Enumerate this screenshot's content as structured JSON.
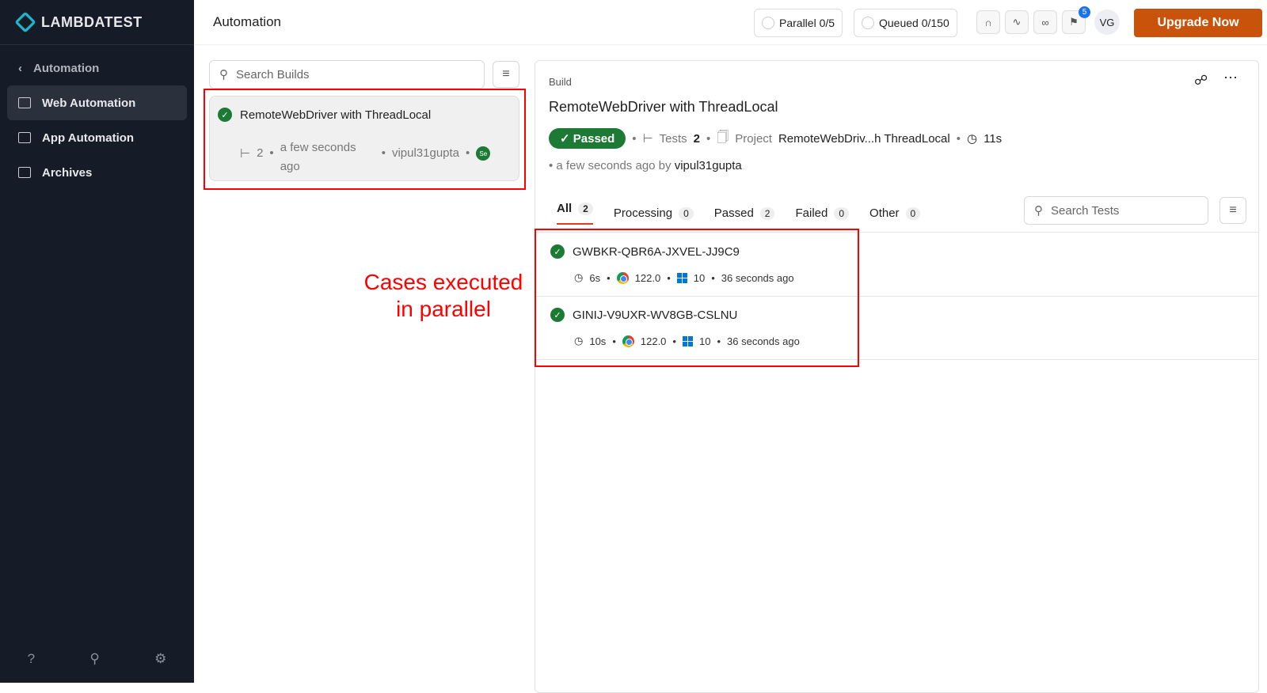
{
  "brand": "LAMBDATEST",
  "sidebar": {
    "back": "Automation",
    "items": [
      {
        "label": "Web Automation"
      },
      {
        "label": "App Automation"
      },
      {
        "label": "Archives"
      }
    ]
  },
  "topbar": {
    "title": "Automation",
    "parallel": "Parallel 0/5",
    "queued": "Queued 0/150",
    "notif_count": "5",
    "avatar": "VG",
    "upgrade": "Upgrade Now"
  },
  "builds": {
    "search_placeholder": "Search Builds",
    "card": {
      "name": "RemoteWebDriver with ThreadLocal",
      "tests": "2",
      "time": "a few seconds ago",
      "user": "vipul31gupta",
      "badge": "Se"
    }
  },
  "detail": {
    "label": "Build",
    "title": "RemoteWebDriver with ThreadLocal",
    "status": "Passed",
    "tests_label": "Tests",
    "tests": "2",
    "project_label": "Project",
    "project": "RemoteWebDriv...h ThreadLocal",
    "duration": "11s",
    "time": "a few seconds ago by",
    "user": "vipul31gupta",
    "tabs": [
      {
        "label": "All",
        "count": "2"
      },
      {
        "label": "Processing",
        "count": "0"
      },
      {
        "label": "Passed",
        "count": "2"
      },
      {
        "label": "Failed",
        "count": "0"
      },
      {
        "label": "Other",
        "count": "0"
      }
    ],
    "search_placeholder": "Search Tests",
    "tests_list": [
      {
        "id": "GWBKR-QBR6A-JXVEL-JJ9C9",
        "duration": "6s",
        "browser": "122.0",
        "os": "10",
        "time": "36 seconds ago"
      },
      {
        "id": "GINIJ-V9UXR-WV8GB-CSLNU",
        "duration": "10s",
        "browser": "122.0",
        "os": "10",
        "time": "36 seconds ago"
      }
    ]
  },
  "annotation": "Cases executed in parallel",
  "colors": {
    "accent": "#c9530b",
    "passed": "#1d7a35",
    "sidebar": "#161c27"
  }
}
